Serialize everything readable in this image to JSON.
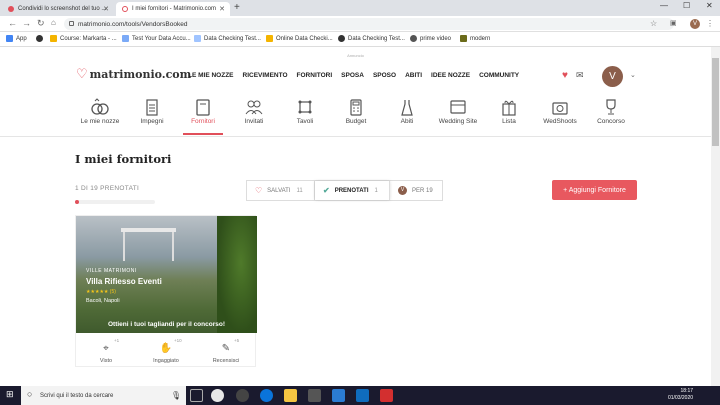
{
  "browser": {
    "tabs": [
      {
        "title": "Condividi lo screenshot del tuo ...",
        "active": false
      },
      {
        "title": "I miei fornitori - Matrimonio.com",
        "active": true
      }
    ],
    "url": "matrimonio.com/tools/VendorsBooked",
    "bookmarks": [
      "App",
      "Course: Markarta - ...",
      "Test Your Data Accu...",
      "Data Checking Test...",
      "Online Data Checki...",
      "Data Checking Test...",
      "prime video",
      "modern"
    ]
  },
  "site": {
    "ad_label": "Annuncio",
    "logo": "matrimonio.com",
    "nav": [
      "LE MIE NOZZE",
      "RICEVIMENTO",
      "FORNITORI",
      "SPOSA",
      "SPOSO",
      "ABITI",
      "IDEE NOZZE",
      "COMMUNITY"
    ],
    "user_initial": "V"
  },
  "subnav": [
    {
      "label": "Le mie nozze",
      "icon": "rings-icon"
    },
    {
      "label": "Impegni",
      "icon": "clipboard-icon"
    },
    {
      "label": "Fornitori",
      "icon": "book-icon",
      "active": true
    },
    {
      "label": "Invitati",
      "icon": "guests-icon"
    },
    {
      "label": "Tavoli",
      "icon": "table-icon"
    },
    {
      "label": "Budget",
      "icon": "calculator-icon"
    },
    {
      "label": "Abiti",
      "icon": "dress-icon"
    },
    {
      "label": "Wedding Site",
      "icon": "website-icon"
    },
    {
      "label": "Lista",
      "icon": "gift-icon"
    },
    {
      "label": "WedShoots",
      "icon": "camera-icon"
    },
    {
      "label": "Concorso",
      "icon": "trophy-icon"
    }
  ],
  "main": {
    "title": "I miei fornitori",
    "count": "1 DI 19 PRENOTATI",
    "progress": 0.05,
    "filters": [
      {
        "label": "SALVATI",
        "count": "11"
      },
      {
        "label": "PRENOTATI",
        "count": "1"
      },
      {
        "label": "PER 19",
        "count": ""
      }
    ],
    "add_button": "+ Aggiungi Fornitore"
  },
  "vendor": {
    "category": "VILLE MATRIMONI",
    "name": "Villa Rifiesso Eventi",
    "rating": "★★★★★ (5)",
    "city": "Bacoli, Napoli",
    "promo": "Ottieni i tuoi tagliandi per il concorso!",
    "actions": [
      {
        "label": "Visto",
        "count": "+1"
      },
      {
        "label": "Ingaggiato",
        "count": "+10"
      },
      {
        "label": "Recensisci",
        "count": "+5"
      }
    ]
  },
  "taskbar": {
    "search_placeholder": "Scrivi qui il testo da cercare",
    "time": "18:17",
    "date": "01/03/2020"
  },
  "colors": {
    "accent": "#e14f5a",
    "button": "#e8585f"
  }
}
